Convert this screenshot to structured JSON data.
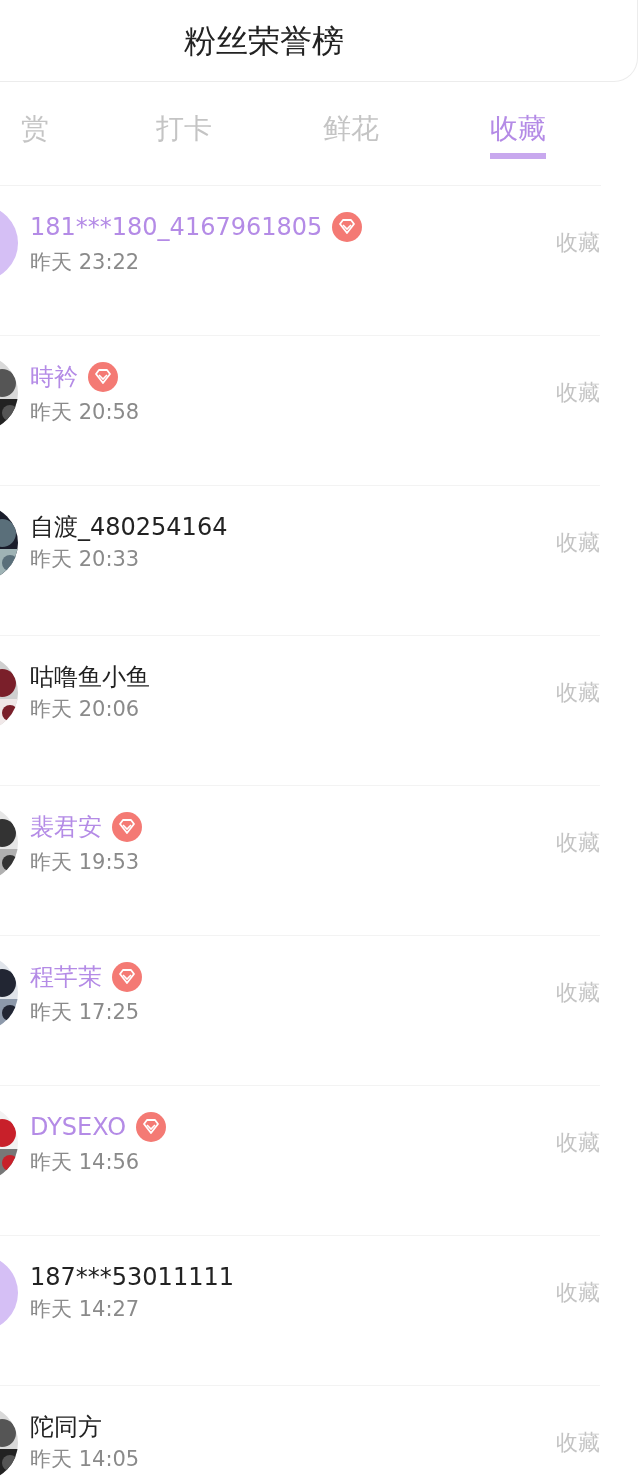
{
  "header": {
    "title": "粉丝荣誉榜"
  },
  "tabs": [
    {
      "label": "赏",
      "selected": false
    },
    {
      "label": "打卡",
      "selected": false
    },
    {
      "label": "鲜花",
      "selected": false
    },
    {
      "label": "收藏",
      "selected": true
    }
  ],
  "rows": [
    {
      "avatar": {
        "kind": "placeholder"
      },
      "name": "181***180_4167961805",
      "vip": true,
      "time": "昨天 23:22",
      "action": "收藏"
    },
    {
      "name": "時衿",
      "vip": true,
      "time": "昨天 20:58",
      "action": "收藏"
    },
    {
      "name": "自渡_480254164",
      "vip": false,
      "time": "昨天 20:33",
      "action": "收藏"
    },
    {
      "name": "咕噜鱼小鱼",
      "vip": false,
      "time": "昨天 20:06",
      "action": "收藏"
    },
    {
      "name": "裴君安",
      "vip": true,
      "time": "昨天 19:53",
      "action": "收藏"
    },
    {
      "name": "程芊茉",
      "vip": true,
      "time": "昨天 17:25",
      "action": "收藏"
    },
    {
      "name": "DYSEXO",
      "vip": true,
      "time": "昨天 14:56",
      "action": "收藏"
    },
    {
      "avatar": {
        "kind": "placeholder"
      },
      "name": "187***53011111",
      "vip": false,
      "time": "昨天 14:27",
      "action": "收藏"
    },
    {
      "name": "陀同方",
      "vip": false,
      "time": "昨天 14:05",
      "action": "收藏"
    }
  ]
}
